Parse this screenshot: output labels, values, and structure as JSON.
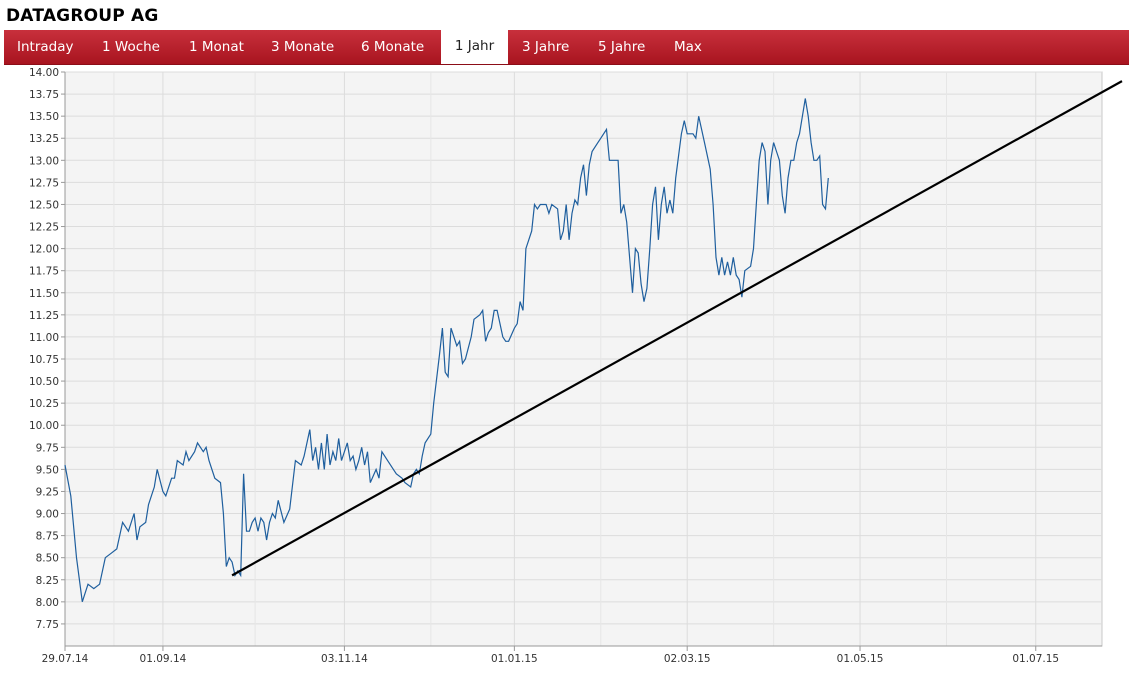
{
  "title": "DATAGROUP AG",
  "tabs": [
    {
      "label": "Intraday",
      "active": false
    },
    {
      "label": "1 Woche",
      "active": false
    },
    {
      "label": "1 Monat",
      "active": false
    },
    {
      "label": "3 Monate",
      "active": false
    },
    {
      "label": "6 Monate",
      "active": false
    },
    {
      "label": "1 Jahr",
      "active": true
    },
    {
      "label": "3 Jahre",
      "active": false
    },
    {
      "label": "5 Jahre",
      "active": false
    },
    {
      "label": "Max",
      "active": false
    }
  ],
  "colors": {
    "tabbar": "#b51c28",
    "line": "#1f5f9e",
    "trendline": "#000000",
    "plot_bg": "#f4f4f4"
  },
  "chart_data": {
    "type": "line",
    "title": "",
    "xlabel": "",
    "ylabel": "",
    "ylim": [
      7.5,
      14.0
    ],
    "yticks": [
      "7.75",
      "8.00",
      "8.25",
      "8.50",
      "8.75",
      "9.00",
      "9.25",
      "9.50",
      "9.75",
      "10.00",
      "10.25",
      "10.50",
      "10.75",
      "11.00",
      "11.25",
      "11.50",
      "11.75",
      "12.00",
      "12.25",
      "12.50",
      "12.75",
      "13.00",
      "13.25",
      "13.50",
      "13.75",
      "14.00"
    ],
    "xticks": [
      {
        "label": "29.07.14",
        "x": 0
      },
      {
        "label": "01.09.14",
        "x": 34
      },
      {
        "label": "03.11.14",
        "x": 97
      },
      {
        "label": "01.01.15",
        "x": 156
      },
      {
        "label": "02.03.15",
        "x": 216
      },
      {
        "label": "01.05.15",
        "x": 276
      },
      {
        "label": "01.07.15",
        "x": 337
      }
    ],
    "x_end": 360,
    "grid": true,
    "series": [
      {
        "points": [
          [
            0,
            9.55
          ],
          [
            2,
            9.2
          ],
          [
            4,
            8.5
          ],
          [
            6,
            8.0
          ],
          [
            8,
            8.2
          ],
          [
            10,
            8.15
          ],
          [
            12,
            8.2
          ],
          [
            14,
            8.5
          ],
          [
            16,
            8.55
          ],
          [
            18,
            8.6
          ],
          [
            20,
            8.9
          ],
          [
            22,
            8.8
          ],
          [
            24,
            9.0
          ],
          [
            25,
            8.7
          ],
          [
            26,
            8.85
          ],
          [
            28,
            8.9
          ],
          [
            29,
            9.1
          ],
          [
            31,
            9.3
          ],
          [
            32,
            9.5
          ],
          [
            34,
            9.25
          ],
          [
            35,
            9.2
          ],
          [
            37,
            9.4
          ],
          [
            38,
            9.4
          ],
          [
            39,
            9.6
          ],
          [
            41,
            9.55
          ],
          [
            42,
            9.7
          ],
          [
            43,
            9.6
          ],
          [
            45,
            9.7
          ],
          [
            46,
            9.8
          ],
          [
            48,
            9.7
          ],
          [
            49,
            9.75
          ],
          [
            50,
            9.6
          ],
          [
            52,
            9.4
          ],
          [
            54,
            9.35
          ],
          [
            55,
            9.0
          ],
          [
            56,
            8.4
          ],
          [
            57,
            8.5
          ],
          [
            58,
            8.45
          ],
          [
            59,
            8.3
          ],
          [
            60,
            8.35
          ],
          [
            61,
            8.3
          ],
          [
            62,
            9.45
          ],
          [
            63,
            8.8
          ],
          [
            64,
            8.8
          ],
          [
            65,
            8.9
          ],
          [
            66,
            8.95
          ],
          [
            67,
            8.8
          ],
          [
            68,
            8.95
          ],
          [
            69,
            8.9
          ],
          [
            70,
            8.7
          ],
          [
            71,
            8.9
          ],
          [
            72,
            9.0
          ],
          [
            73,
            8.95
          ],
          [
            74,
            9.15
          ],
          [
            76,
            8.9
          ],
          [
            78,
            9.05
          ],
          [
            80,
            9.6
          ],
          [
            82,
            9.55
          ],
          [
            83,
            9.65
          ],
          [
            85,
            9.95
          ],
          [
            86,
            9.6
          ],
          [
            87,
            9.75
          ],
          [
            88,
            9.5
          ],
          [
            89,
            9.8
          ],
          [
            90,
            9.5
          ],
          [
            91,
            9.9
          ],
          [
            92,
            9.55
          ],
          [
            93,
            9.7
          ],
          [
            94,
            9.6
          ],
          [
            95,
            9.85
          ],
          [
            96,
            9.6
          ],
          [
            98,
            9.8
          ],
          [
            99,
            9.6
          ],
          [
            100,
            9.65
          ],
          [
            101,
            9.5
          ],
          [
            102,
            9.6
          ],
          [
            103,
            9.75
          ],
          [
            104,
            9.55
          ],
          [
            105,
            9.7
          ],
          [
            106,
            9.35
          ],
          [
            108,
            9.5
          ],
          [
            109,
            9.4
          ],
          [
            110,
            9.7
          ],
          [
            112,
            9.6
          ],
          [
            114,
            9.5
          ],
          [
            115,
            9.45
          ],
          [
            117,
            9.4
          ],
          [
            118,
            9.35
          ],
          [
            120,
            9.3
          ],
          [
            121,
            9.45
          ],
          [
            122,
            9.5
          ],
          [
            123,
            9.45
          ],
          [
            124,
            9.65
          ],
          [
            125,
            9.8
          ],
          [
            127,
            9.9
          ],
          [
            128,
            10.25
          ],
          [
            130,
            10.8
          ],
          [
            131,
            11.1
          ],
          [
            132,
            10.6
          ],
          [
            133,
            10.55
          ],
          [
            134,
            11.1
          ],
          [
            136,
            10.9
          ],
          [
            137,
            10.95
          ],
          [
            138,
            10.7
          ],
          [
            139,
            10.75
          ],
          [
            141,
            11.0
          ],
          [
            142,
            11.2
          ],
          [
            144,
            11.25
          ],
          [
            145,
            11.3
          ],
          [
            146,
            10.95
          ],
          [
            147,
            11.05
          ],
          [
            148,
            11.1
          ],
          [
            149,
            11.3
          ],
          [
            150,
            11.3
          ],
          [
            151,
            11.15
          ],
          [
            152,
            11.0
          ],
          [
            153,
            10.95
          ],
          [
            154,
            10.95
          ],
          [
            156,
            11.1
          ],
          [
            157,
            11.15
          ],
          [
            158,
            11.4
          ],
          [
            159,
            11.3
          ],
          [
            160,
            12.0
          ],
          [
            161,
            12.1
          ],
          [
            162,
            12.2
          ],
          [
            163,
            12.5
          ],
          [
            164,
            12.45
          ],
          [
            165,
            12.5
          ],
          [
            167,
            12.5
          ],
          [
            168,
            12.4
          ],
          [
            169,
            12.5
          ],
          [
            171,
            12.45
          ],
          [
            172,
            12.1
          ],
          [
            173,
            12.2
          ],
          [
            174,
            12.5
          ],
          [
            175,
            12.1
          ],
          [
            176,
            12.4
          ],
          [
            177,
            12.55
          ],
          [
            178,
            12.5
          ],
          [
            179,
            12.8
          ],
          [
            180,
            12.95
          ],
          [
            181,
            12.6
          ],
          [
            182,
            12.95
          ],
          [
            183,
            13.1
          ],
          [
            185,
            13.2
          ],
          [
            186,
            13.25
          ],
          [
            188,
            13.35
          ],
          [
            189,
            13.0
          ],
          [
            190,
            13.0
          ],
          [
            192,
            13.0
          ],
          [
            193,
            12.4
          ],
          [
            194,
            12.5
          ],
          [
            195,
            12.3
          ],
          [
            196,
            11.9
          ],
          [
            197,
            11.5
          ],
          [
            198,
            12.0
          ],
          [
            199,
            11.95
          ],
          [
            200,
            11.6
          ],
          [
            201,
            11.4
          ],
          [
            202,
            11.55
          ],
          [
            203,
            12.0
          ],
          [
            204,
            12.5
          ],
          [
            205,
            12.7
          ],
          [
            206,
            12.1
          ],
          [
            207,
            12.5
          ],
          [
            208,
            12.7
          ],
          [
            209,
            12.4
          ],
          [
            210,
            12.55
          ],
          [
            211,
            12.4
          ],
          [
            212,
            12.8
          ],
          [
            214,
            13.3
          ],
          [
            215,
            13.45
          ],
          [
            216,
            13.3
          ],
          [
            218,
            13.3
          ],
          [
            219,
            13.25
          ],
          [
            220,
            13.5
          ],
          [
            222,
            13.2
          ],
          [
            224,
            12.9
          ],
          [
            225,
            12.5
          ],
          [
            226,
            11.9
          ],
          [
            227,
            11.7
          ],
          [
            228,
            11.9
          ],
          [
            229,
            11.7
          ],
          [
            230,
            11.85
          ],
          [
            231,
            11.7
          ],
          [
            232,
            11.9
          ],
          [
            233,
            11.7
          ],
          [
            234,
            11.65
          ],
          [
            235,
            11.45
          ],
          [
            236,
            11.75
          ],
          [
            238,
            11.8
          ],
          [
            239,
            12.0
          ],
          [
            240,
            12.5
          ],
          [
            241,
            13.0
          ],
          [
            242,
            13.2
          ],
          [
            243,
            13.1
          ],
          [
            244,
            12.5
          ],
          [
            245,
            13.0
          ],
          [
            246,
            13.2
          ],
          [
            247,
            13.1
          ],
          [
            248,
            13.0
          ],
          [
            249,
            12.6
          ],
          [
            250,
            12.4
          ],
          [
            251,
            12.8
          ],
          [
            252,
            13.0
          ],
          [
            253,
            13.0
          ],
          [
            254,
            13.2
          ],
          [
            255,
            13.3
          ],
          [
            256,
            13.5
          ],
          [
            257,
            13.7
          ],
          [
            258,
            13.5
          ],
          [
            259,
            13.2
          ],
          [
            260,
            13.0
          ],
          [
            261,
            13.0
          ],
          [
            262,
            13.05
          ],
          [
            263,
            12.5
          ],
          [
            264,
            12.45
          ],
          [
            265,
            12.8
          ]
        ]
      }
    ],
    "trendline": [
      [
        58,
        8.3
      ],
      [
        265,
        12.05
      ]
    ]
  }
}
